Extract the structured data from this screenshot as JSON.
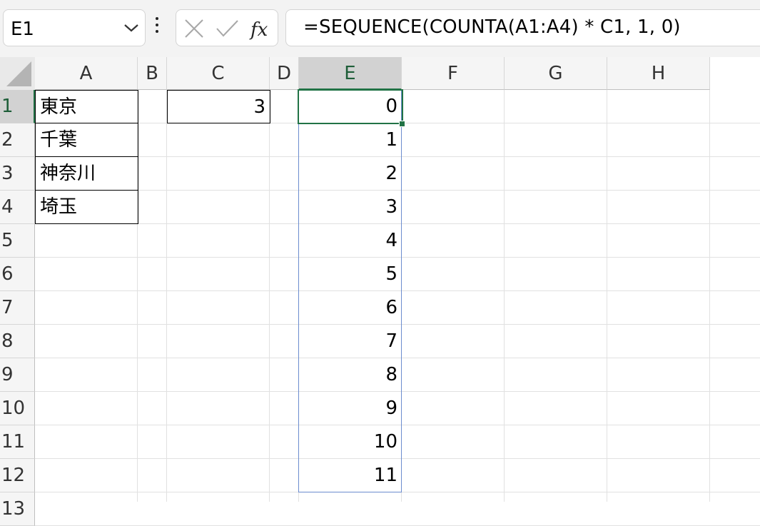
{
  "formula_bar": {
    "name_box": "E1",
    "formula": "=SEQUENCE(COUNTA(A1:A4) * C1, 1, 0)",
    "icons": [
      "chevron-down-icon",
      "more-options-icon",
      "cancel-icon",
      "enter-icon",
      "insert-function-icon"
    ]
  },
  "grid": {
    "columns": [
      "A",
      "B",
      "C",
      "D",
      "E",
      "F",
      "G",
      "H"
    ],
    "rows": [
      "1",
      "2",
      "3",
      "4",
      "5",
      "6",
      "7",
      "8",
      "9",
      "10",
      "11",
      "12",
      "13"
    ],
    "selected_column": "E",
    "selected_row": "1",
    "column_a": [
      "東京",
      "千葉",
      "神奈川",
      "埼玉"
    ],
    "c1": "3",
    "column_e": [
      "0",
      "1",
      "2",
      "3",
      "4",
      "5",
      "6",
      "7",
      "8",
      "9",
      "10",
      "11"
    ]
  },
  "colors": {
    "accent_green": "#217346",
    "spill_blue": "#6b8ccf",
    "header_selected": "#d2d2d2"
  }
}
